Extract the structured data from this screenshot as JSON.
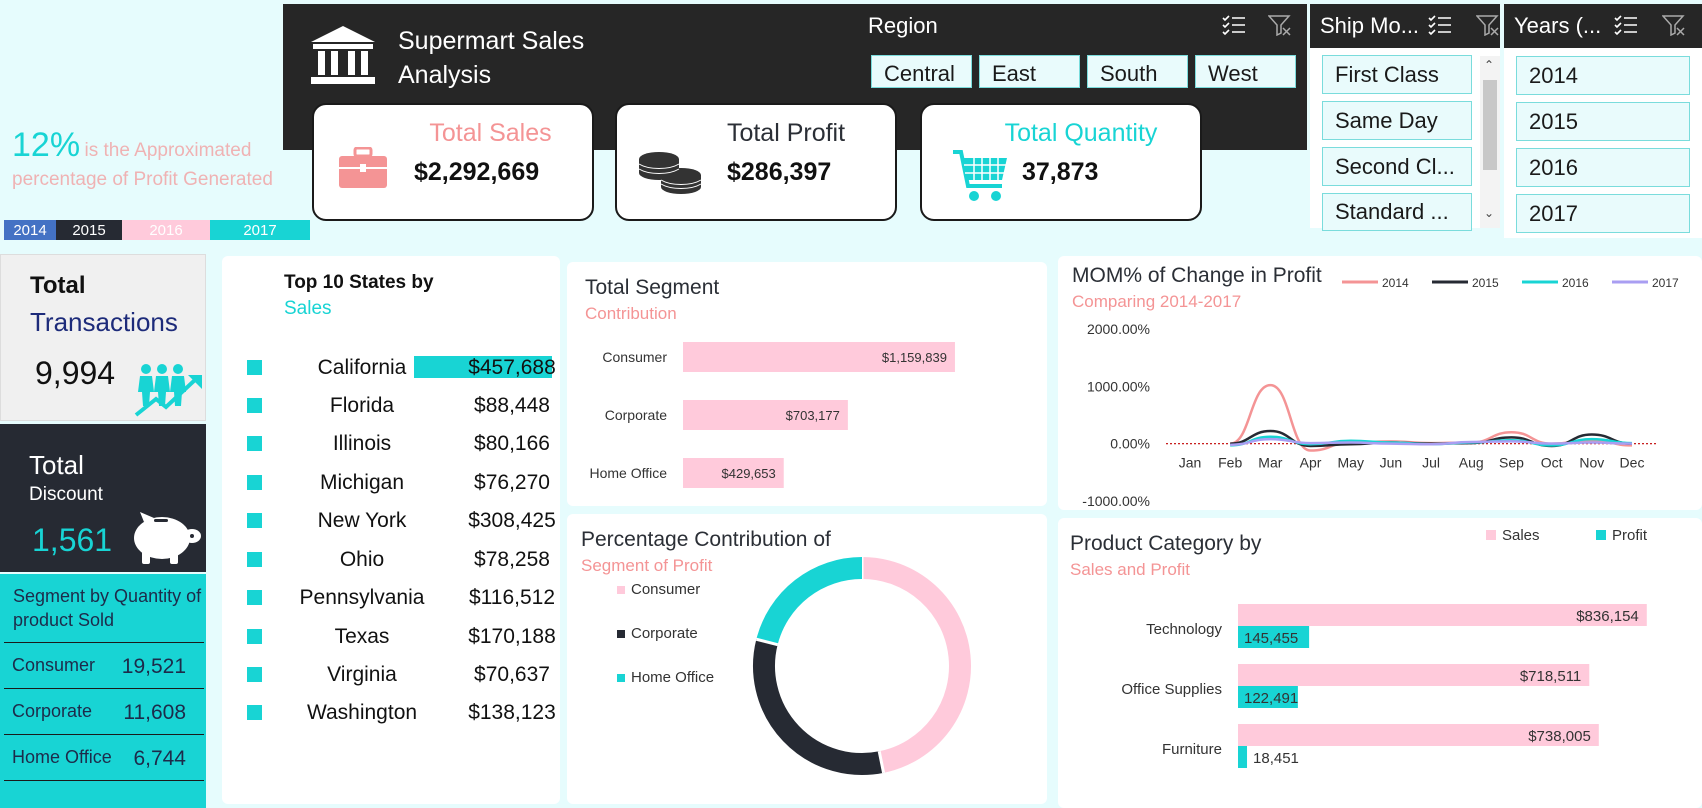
{
  "header": {
    "title_line1": "Supermart Sales",
    "title_line2": "Analysis"
  },
  "slicers": {
    "region": {
      "title": "Region",
      "options": [
        "Central",
        "East",
        "South",
        "West"
      ]
    },
    "ship_mode": {
      "title": "Ship Mo...",
      "options": [
        "First Class",
        "Same Day",
        "Second Cl...",
        "Standard ..."
      ]
    },
    "years": {
      "title": "Years (...",
      "options": [
        "2014",
        "2015",
        "2016",
        "2017"
      ]
    }
  },
  "kpis": {
    "sales": {
      "label": "Total Sales",
      "value": "$2,292,669"
    },
    "profit": {
      "label": "Total Profit",
      "value": "$286,397"
    },
    "quantity": {
      "label": "Total Quantity",
      "value": "37,873"
    }
  },
  "profit_note": {
    "percent": "12%",
    "text1": "is the Approximated",
    "text2": "percentage of Profit Generated"
  },
  "year_legend": [
    {
      "label": "2014",
      "color": "#4472c4"
    },
    {
      "label": "2015",
      "color": "#262a33"
    },
    {
      "label": "2016",
      "color": "#ffcadb"
    },
    {
      "label": "2017",
      "color": "#18d4d4"
    }
  ],
  "transactions": {
    "title1": "Total",
    "title2": "Transactions",
    "value": "9,994"
  },
  "discount": {
    "title1": "Total",
    "title2": "Discount",
    "value": "1,561"
  },
  "segment_quantity": {
    "title": "Segment by Quantity of product Sold",
    "rows": [
      {
        "name": "Consumer",
        "value": "19,521"
      },
      {
        "name": "Corporate",
        "value": "11,608"
      },
      {
        "name": "Home Office",
        "value": "6,744"
      }
    ]
  },
  "top_states": {
    "title1": "Top 10 States by",
    "title2": "Sales",
    "rows": [
      {
        "name": "California",
        "value": "$457,688",
        "highlight": true
      },
      {
        "name": "Florida",
        "value": "$88,448"
      },
      {
        "name": "Illinois",
        "value": "$80,166"
      },
      {
        "name": "Michigan",
        "value": "$76,270"
      },
      {
        "name": "New York",
        "value": "$308,425"
      },
      {
        "name": "Ohio",
        "value": "$78,258"
      },
      {
        "name": "Pennsylvania",
        "value": "$116,512"
      },
      {
        "name": "Texas",
        "value": "$170,188"
      },
      {
        "name": "Virginia",
        "value": "$70,637"
      },
      {
        "name": "Washington",
        "value": "$138,123"
      }
    ]
  },
  "colors": {
    "teal": "#18d4d4",
    "pink": "#ffcadb",
    "salmon": "#f49495",
    "dark": "#262a33",
    "navy": "#1d2b4a"
  },
  "chart_data": [
    {
      "type": "bar",
      "title": "Total Segment",
      "subtitle": "Contribution",
      "categories": [
        "Consumer",
        "Corporate",
        "Home Office"
      ],
      "values": [
        1159839,
        703177,
        429653
      ],
      "labels": [
        "$1,159,839",
        "$703,177",
        "$429,653"
      ],
      "orientation": "horizontal",
      "xlim": [
        0,
        1450000
      ]
    },
    {
      "type": "pie",
      "title": "Percentage Contribution of",
      "subtitle": "Segment of Profit",
      "categories": [
        "Consumer",
        "Corporate",
        "Home Office"
      ],
      "values": [
        134119,
        91979,
        60299
      ],
      "colors": [
        "#ffcadb",
        "#262a33",
        "#18d4d4"
      ],
      "legend": "left"
    },
    {
      "type": "line",
      "title": "MOM% of Change in Profit",
      "subtitle": "Comparing 2014-2017",
      "x": [
        "Jan",
        "Feb",
        "Mar",
        "Apr",
        "May",
        "Jun",
        "Jul",
        "Aug",
        "Sep",
        "Oct",
        "Nov",
        "Dec"
      ],
      "ylim": [
        -1000,
        2000
      ],
      "yticks": [
        "2000.00%",
        "1000.00%",
        "0.00%",
        "-1000.00%"
      ],
      "ytick_values": [
        2000,
        1000,
        0,
        -1000
      ],
      "legend": "top-right",
      "series": [
        {
          "name": "2014",
          "color": "#f49495",
          "values": [
            null,
            0,
            1020,
            -120,
            20,
            40,
            10,
            20,
            200,
            0,
            60,
            -30
          ]
        },
        {
          "name": "2015",
          "color": "#262a33",
          "values": [
            null,
            0,
            220,
            -40,
            -10,
            20,
            0,
            10,
            110,
            -40,
            160,
            0
          ]
        },
        {
          "name": "2016",
          "color": "#18d4d4",
          "values": [
            null,
            -30,
            120,
            -10,
            50,
            20,
            -10,
            20,
            60,
            -30,
            80,
            10
          ]
        },
        {
          "name": "2017",
          "color": "#a99ef2",
          "values": [
            null,
            -20,
            80,
            10,
            20,
            0,
            -10,
            30,
            40,
            0,
            20,
            0
          ]
        }
      ]
    },
    {
      "type": "bar",
      "title": "Product Category by",
      "subtitle": "Sales and Profit",
      "orientation": "horizontal",
      "categories": [
        "Technology",
        "Office Supplies",
        "Furniture"
      ],
      "legend": "top-right",
      "xlim": [
        0,
        900000
      ],
      "series": [
        {
          "name": "Sales",
          "color": "#ffcadb",
          "values": [
            836154,
            718511,
            738005
          ],
          "labels": [
            "$836,154",
            "$718,511",
            "$738,005"
          ]
        },
        {
          "name": "Profit",
          "color": "#18d4d4",
          "values": [
            145455,
            122491,
            18451
          ],
          "labels": [
            "145,455",
            "122,491",
            "18,451"
          ]
        }
      ]
    }
  ]
}
